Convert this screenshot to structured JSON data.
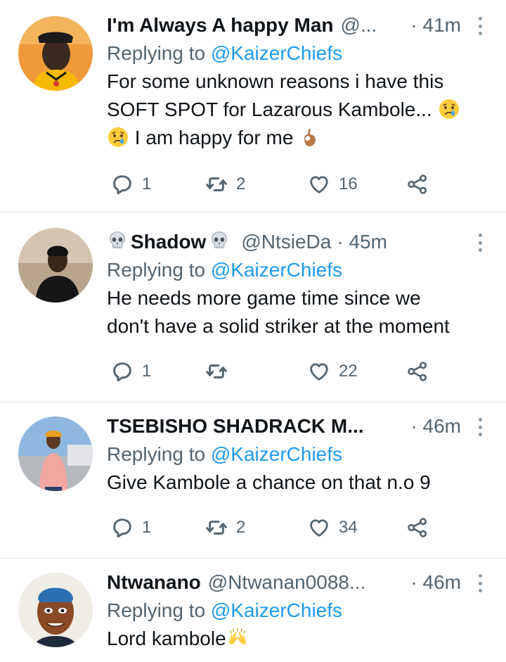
{
  "tweets": [
    {
      "name": "I'm Always A happy Man",
      "handle": "@...",
      "time": "· 41m",
      "replying_prefix": "Replying to",
      "replying_to": "@KaizerChiefs",
      "lines": [
        "For some unknown reasons i have this",
        "SOFT SPOT for Lazarous Kambole...",
        "I am happy for me"
      ],
      "replies": "1",
      "retweets": "2",
      "likes": "16"
    },
    {
      "name": "Shadow",
      "handle": "@NtsieDa",
      "time": "· 45m",
      "replying_prefix": "Replying to",
      "replying_to": "@KaizerChiefs",
      "lines": [
        "He needs more game time since we",
        "don't have a solid striker at the moment"
      ],
      "replies": "1",
      "retweets": "",
      "likes": "22"
    },
    {
      "name": "TSEBISHO SHADRACK M...",
      "handle": "",
      "time": "· 46m",
      "replying_prefix": "Replying to",
      "replying_to": "@KaizerChiefs",
      "lines": [
        "Give Kambole a chance on that n.o 9"
      ],
      "replies": "1",
      "retweets": "2",
      "likes": "34"
    },
    {
      "name": "Ntwanano",
      "handle": "@Ntwanan0088...",
      "time": "· 46m",
      "replying_prefix": "Replying to",
      "replying_to": "@KaizerChiefs",
      "lines": [
        "Lord kambole"
      ],
      "replies": "",
      "retweets": "",
      "likes": ""
    }
  ],
  "icons": {
    "reply": "reply-icon",
    "retweet": "retweet-icon",
    "like": "heart-icon",
    "share": "share-icon",
    "more": "more-vertical-icon"
  },
  "colors": {
    "link": "#1d9bf0",
    "secondary": "#536471",
    "divider": "#e3e7ea"
  }
}
